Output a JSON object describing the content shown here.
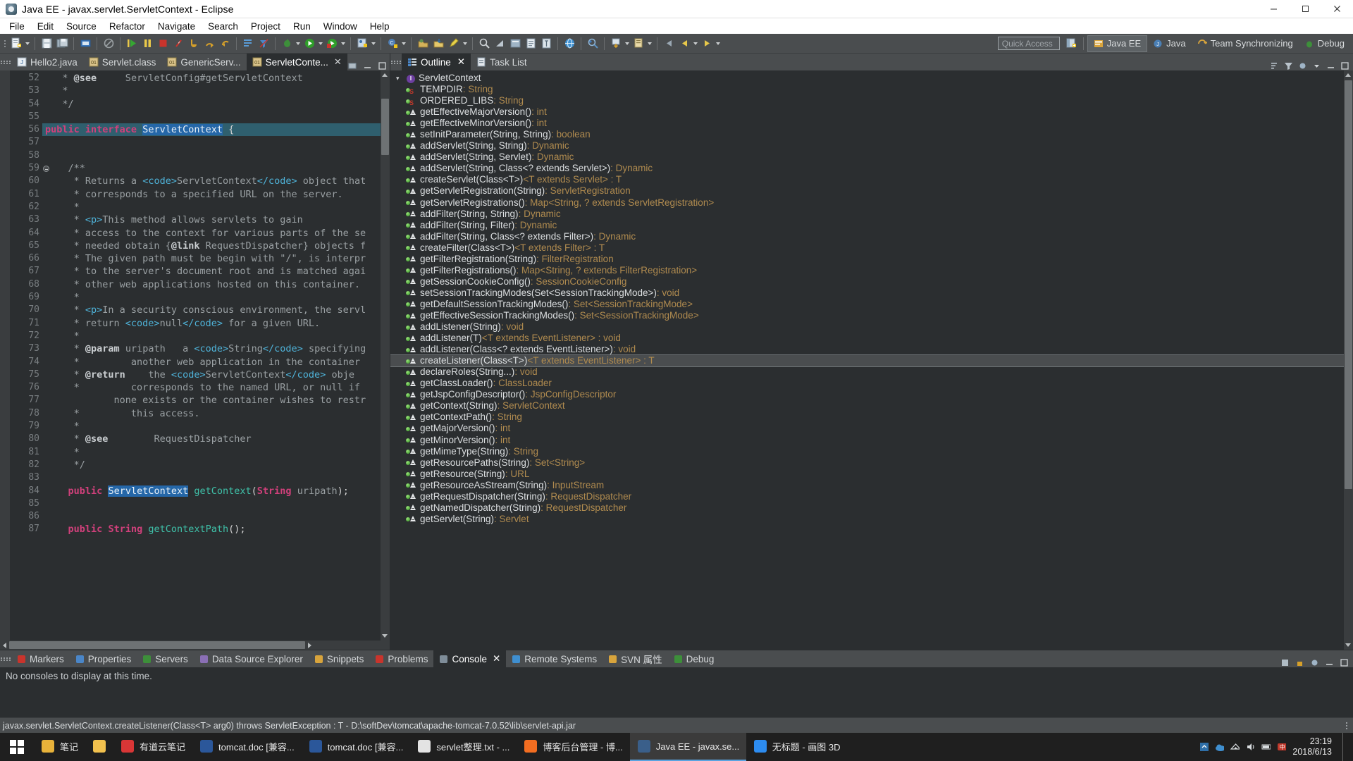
{
  "window": {
    "title": "Java EE - javax.servlet.ServletContext - Eclipse",
    "icon": "eclipse-icon",
    "minimize": "minimize-button",
    "maximize": "maximize-button",
    "close": "close-button"
  },
  "menubar": {
    "items": [
      "File",
      "Edit",
      "Source",
      "Refactor",
      "Navigate",
      "Search",
      "Project",
      "Run",
      "Window",
      "Help"
    ]
  },
  "toolbar": {
    "quick_access_placeholder": "Quick Access",
    "perspectives": [
      {
        "label": "Java EE",
        "active": true
      },
      {
        "label": "Java",
        "active": false
      },
      {
        "label": "Team Synchronizing",
        "active": false
      },
      {
        "label": "Debug",
        "active": false
      }
    ]
  },
  "editor": {
    "tabs": [
      {
        "label": "Hello2.java",
        "active": false,
        "closable": false
      },
      {
        "label": "Servlet.class",
        "active": false,
        "closable": false
      },
      {
        "label": "GenericServ...",
        "active": false,
        "closable": false
      },
      {
        "label": "ServletConte...",
        "active": true,
        "closable": true
      }
    ],
    "first_line_number": 52,
    "highlight_line": 56,
    "fold_line": 59,
    "lines": [
      {
        "n": 52,
        "html": "   <span class='cmt'>* </span><span class='jdoc-b'>@see</span><span class='cmt'>     ServletConfig#getServletContext</span>"
      },
      {
        "n": 53,
        "html": "   <span class='cmt'>*</span>"
      },
      {
        "n": 54,
        "html": "   <span class='cmt'>*/</span>"
      },
      {
        "n": 55,
        "html": ""
      },
      {
        "n": 56,
        "html": "<span class='k'>public interface</span> <span class='sel'>ServletContext</span> {"
      },
      {
        "n": 57,
        "html": ""
      },
      {
        "n": 58,
        "html": ""
      },
      {
        "n": 59,
        "html": "    <span class='cmt'>/**</span>"
      },
      {
        "n": 60,
        "html": "     <span class='cmt'>* Returns a </span><span class='tag'>&lt;code&gt;</span><span class='cmt'>ServletContext</span><span class='tag'>&lt;/code&gt;</span><span class='cmt'> object that</span>"
      },
      {
        "n": 61,
        "html": "     <span class='cmt'>* corresponds to a specified URL on the server.</span>"
      },
      {
        "n": 62,
        "html": "     <span class='cmt'>*</span>"
      },
      {
        "n": 63,
        "html": "     <span class='cmt'>* </span><span class='tag'>&lt;p&gt;</span><span class='cmt'>This method allows servlets to gain</span>"
      },
      {
        "n": 64,
        "html": "     <span class='cmt'>* access to the context for various parts of the se</span>"
      },
      {
        "n": 65,
        "html": "     <span class='cmt'>* needed obtain {</span><span class='jdoc-b'>@link</span><span class='cmt'> RequestDispatcher} objects f</span>"
      },
      {
        "n": 66,
        "html": "     <span class='cmt'>* The given path must be begin with \"/\", is interpr</span>"
      },
      {
        "n": 67,
        "html": "     <span class='cmt'>* to the server's document root and is matched agai</span>"
      },
      {
        "n": 68,
        "html": "     <span class='cmt'>* other web applications hosted on this container.</span>"
      },
      {
        "n": 69,
        "html": "     <span class='cmt'>*</span>"
      },
      {
        "n": 70,
        "html": "     <span class='cmt'>* </span><span class='tag'>&lt;p&gt;</span><span class='cmt'>In a security conscious environment, the servl</span>"
      },
      {
        "n": 71,
        "html": "     <span class='cmt'>* return </span><span class='tag'>&lt;code&gt;</span><span class='cmt'>null</span><span class='tag'>&lt;/code&gt;</span><span class='cmt'> for a given URL.</span>"
      },
      {
        "n": 72,
        "html": "     <span class='cmt'>*</span>"
      },
      {
        "n": 73,
        "html": "     <span class='cmt'>* </span><span class='jdoc-b'>@param</span><span class='cmt'> uripath   a </span><span class='tag'>&lt;code&gt;</span><span class='cmt'>String</span><span class='tag'>&lt;/code&gt;</span><span class='cmt'> specifying</span>"
      },
      {
        "n": 74,
        "html": "     <span class='cmt'>*         another web application in the container</span>"
      },
      {
        "n": 75,
        "html": "     <span class='cmt'>* </span><span class='jdoc-b'>@return</span><span class='cmt'>    the </span><span class='tag'>&lt;code&gt;</span><span class='cmt'>ServletContext</span><span class='tag'>&lt;/code&gt;</span><span class='cmt'> obje</span>"
      },
      {
        "n": 76,
        "html": "     <span class='cmt'>*         corresponds to the named URL, or null if</span>"
      },
      {
        "n": 77,
        "html": "     <span class='cmt'>       none exists or the container wishes to restr</span>"
      },
      {
        "n": 78,
        "html": "     <span class='cmt'>*         this access.</span>"
      },
      {
        "n": 79,
        "html": "     <span class='cmt'>*</span>"
      },
      {
        "n": 80,
        "html": "     <span class='cmt'>* </span><span class='jdoc-b'>@see</span><span class='cmt'>        RequestDispatcher</span>"
      },
      {
        "n": 81,
        "html": "     <span class='cmt'>*</span>"
      },
      {
        "n": 82,
        "html": "     <span class='cmt'>*/</span>"
      },
      {
        "n": 83,
        "html": ""
      },
      {
        "n": 84,
        "html": "    <span class='k'>public</span> <span class='sel'>ServletContext</span> <span class='typ'>getContext</span>(<span class='k'>String</span> <span class='vbl'>uripath</span>);"
      },
      {
        "n": 85,
        "html": ""
      },
      {
        "n": 86,
        "html": ""
      },
      {
        "n": 87,
        "html": "    <span class='k'>public</span> <span class='k'>String</span> <span class='typ'>getContextPath</span>();"
      }
    ]
  },
  "outline": {
    "tabs": [
      {
        "label": "Outline",
        "active": true,
        "closable": true,
        "icon": "outline-icon"
      },
      {
        "label": "Task List",
        "active": false,
        "closable": false,
        "icon": "tasklist-icon"
      }
    ],
    "root": {
      "name": "ServletContext",
      "icon": "interface-icon"
    },
    "selected_index": 27,
    "items": [
      {
        "name": "TEMPDIR",
        "type": " : String",
        "icon": "static-field-icon"
      },
      {
        "name": "ORDERED_LIBS",
        "type": " : String",
        "icon": "static-field-icon"
      },
      {
        "name": "getEffectiveMajorVersion()",
        "type": " : int",
        "icon": "method-icon"
      },
      {
        "name": "getEffectiveMinorVersion()",
        "type": " : int",
        "icon": "method-icon"
      },
      {
        "name": "setInitParameter(String, String)",
        "type": " : boolean",
        "icon": "method-icon"
      },
      {
        "name": "addServlet(String, String)",
        "type": " : Dynamic",
        "icon": "method-icon"
      },
      {
        "name": "addServlet(String, Servlet)",
        "type": " : Dynamic",
        "icon": "method-icon"
      },
      {
        "name": "addServlet(String, Class<? extends Servlet>)",
        "type": " : Dynamic",
        "icon": "method-icon"
      },
      {
        "name": "createServlet(Class<T>)",
        "type": " <T extends Servlet> : T",
        "icon": "method-icon"
      },
      {
        "name": "getServletRegistration(String)",
        "type": " : ServletRegistration",
        "icon": "method-icon"
      },
      {
        "name": "getServletRegistrations()",
        "type": " : Map<String, ? extends ServletRegistration>",
        "icon": "method-icon"
      },
      {
        "name": "addFilter(String, String)",
        "type": " : Dynamic",
        "icon": "method-icon"
      },
      {
        "name": "addFilter(String, Filter)",
        "type": " : Dynamic",
        "icon": "method-icon"
      },
      {
        "name": "addFilter(String, Class<? extends Filter>)",
        "type": " : Dynamic",
        "icon": "method-icon"
      },
      {
        "name": "createFilter(Class<T>)",
        "type": " <T extends Filter> : T",
        "icon": "method-icon"
      },
      {
        "name": "getFilterRegistration(String)",
        "type": " : FilterRegistration",
        "icon": "method-icon"
      },
      {
        "name": "getFilterRegistrations()",
        "type": " : Map<String, ? extends FilterRegistration>",
        "icon": "method-icon"
      },
      {
        "name": "getSessionCookieConfig()",
        "type": " : SessionCookieConfig",
        "icon": "method-icon"
      },
      {
        "name": "setSessionTrackingModes(Set<SessionTrackingMode>)",
        "type": " : void",
        "icon": "method-icon"
      },
      {
        "name": "getDefaultSessionTrackingModes()",
        "type": " : Set<SessionTrackingMode>",
        "icon": "method-icon"
      },
      {
        "name": "getEffectiveSessionTrackingModes()",
        "type": " : Set<SessionTrackingMode>",
        "icon": "method-icon"
      },
      {
        "name": "addListener(String)",
        "type": " : void",
        "icon": "method-icon"
      },
      {
        "name": "addListener(T)",
        "type": " <T extends EventListener> : void",
        "icon": "method-icon"
      },
      {
        "name": "addListener(Class<? extends EventListener>)",
        "type": " : void",
        "icon": "method-icon"
      },
      {
        "name": "createListener(Class<T>)",
        "type": " <T extends EventListener> : T",
        "icon": "method-icon",
        "selected": true
      },
      {
        "name": "declareRoles(String...)",
        "type": " : void",
        "icon": "method-icon"
      },
      {
        "name": "getClassLoader()",
        "type": " : ClassLoader",
        "icon": "method-icon"
      },
      {
        "name": "getJspConfigDescriptor()",
        "type": " : JspConfigDescriptor",
        "icon": "method-icon"
      },
      {
        "name": "getContext(String)",
        "type": " : ServletContext",
        "icon": "method-icon"
      },
      {
        "name": "getContextPath()",
        "type": " : String",
        "icon": "method-icon"
      },
      {
        "name": "getMajorVersion()",
        "type": " : int",
        "icon": "method-icon"
      },
      {
        "name": "getMinorVersion()",
        "type": " : int",
        "icon": "method-icon"
      },
      {
        "name": "getMimeType(String)",
        "type": " : String",
        "icon": "method-icon"
      },
      {
        "name": "getResourcePaths(String)",
        "type": " : Set<String>",
        "icon": "method-icon"
      },
      {
        "name": "getResource(String)",
        "type": " : URL",
        "icon": "method-icon"
      },
      {
        "name": "getResourceAsStream(String)",
        "type": " : InputStream",
        "icon": "method-icon"
      },
      {
        "name": "getRequestDispatcher(String)",
        "type": " : RequestDispatcher",
        "icon": "method-icon"
      },
      {
        "name": "getNamedDispatcher(String)",
        "type": " : RequestDispatcher",
        "icon": "method-icon"
      },
      {
        "name": "getServlet(String)",
        "type": " : Servlet",
        "icon": "method-icon"
      }
    ]
  },
  "bottom_panel": {
    "tabs": [
      {
        "label": "Markers",
        "active": false,
        "closable": false,
        "icon": "markers-icon"
      },
      {
        "label": "Properties",
        "active": false,
        "closable": false,
        "icon": "properties-icon"
      },
      {
        "label": "Servers",
        "active": false,
        "closable": false,
        "icon": "servers-icon"
      },
      {
        "label": "Data Source Explorer",
        "active": false,
        "closable": false,
        "icon": "datasource-icon"
      },
      {
        "label": "Snippets",
        "active": false,
        "closable": false,
        "icon": "snippets-icon"
      },
      {
        "label": "Problems",
        "active": false,
        "closable": false,
        "icon": "problems-icon"
      },
      {
        "label": "Console",
        "active": true,
        "closable": true,
        "icon": "console-icon"
      },
      {
        "label": "Remote Systems",
        "active": false,
        "closable": false,
        "icon": "remote-icon"
      },
      {
        "label": "SVN 属性",
        "active": false,
        "closable": false,
        "icon": "svn-icon"
      },
      {
        "label": "Debug",
        "active": false,
        "closable": false,
        "icon": "debug-icon"
      }
    ],
    "console_message": "No consoles to display at this time."
  },
  "statusbar": {
    "text": "javax.servlet.ServletContext.createListener(Class<T> arg0) throws ServletException : T - D:\\softDev\\tomcat\\apache-tomcat-7.0.52\\lib\\servlet-api.jar"
  },
  "taskbar": {
    "start": "windows-start-button",
    "items": [
      {
        "label": "笔记",
        "icon": "note-icon",
        "active": false,
        "color": "#e8b23a"
      },
      {
        "label": "",
        "icon": "explorer-icon",
        "active": false,
        "color": "#f2c14e"
      },
      {
        "label": "有道云笔记",
        "icon": "youdao-icon",
        "active": false,
        "color": "#d93636"
      },
      {
        "label": "tomcat.doc [兼容...",
        "icon": "word-icon",
        "active": false,
        "color": "#2b579a"
      },
      {
        "label": "tomcat.doc [兼容...",
        "icon": "word-icon",
        "active": false,
        "color": "#2b579a"
      },
      {
        "label": "servlet整理.txt - ...",
        "icon": "notepad-icon",
        "active": false,
        "color": "#e3e3e3"
      },
      {
        "label": "博客后台管理 - 博...",
        "icon": "browser-icon",
        "active": false,
        "color": "#f26d21"
      },
      {
        "label": "Java EE - javax.se...",
        "icon": "eclipse-icon",
        "active": true,
        "color": "#3a5f8a"
      },
      {
        "label": "无标题 - 画图 3D",
        "icon": "paint3d-icon",
        "active": false,
        "color": "#2d8cf0"
      }
    ],
    "tray_icons": [
      "network-icon",
      "volume-icon",
      "battery-icon",
      "ime-icon",
      "cloud-icon"
    ],
    "clock_time": "23:19",
    "clock_date": "2018/6/13"
  }
}
